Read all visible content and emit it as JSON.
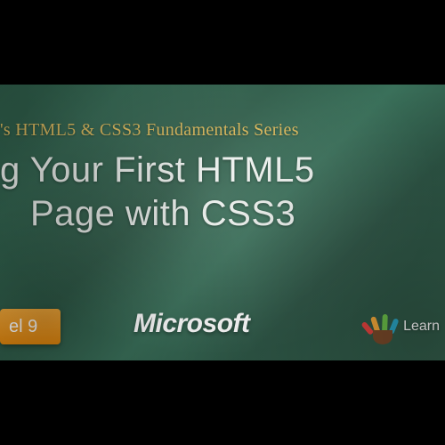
{
  "series_label": "'s HTML5 & CSS3 Fundamentals Series",
  "title_line1": "g Your First HTML5",
  "title_line2": "Page with CSS3",
  "channel9_label": "el 9",
  "microsoft_label": "Microsoft",
  "learn_label": "Learn"
}
